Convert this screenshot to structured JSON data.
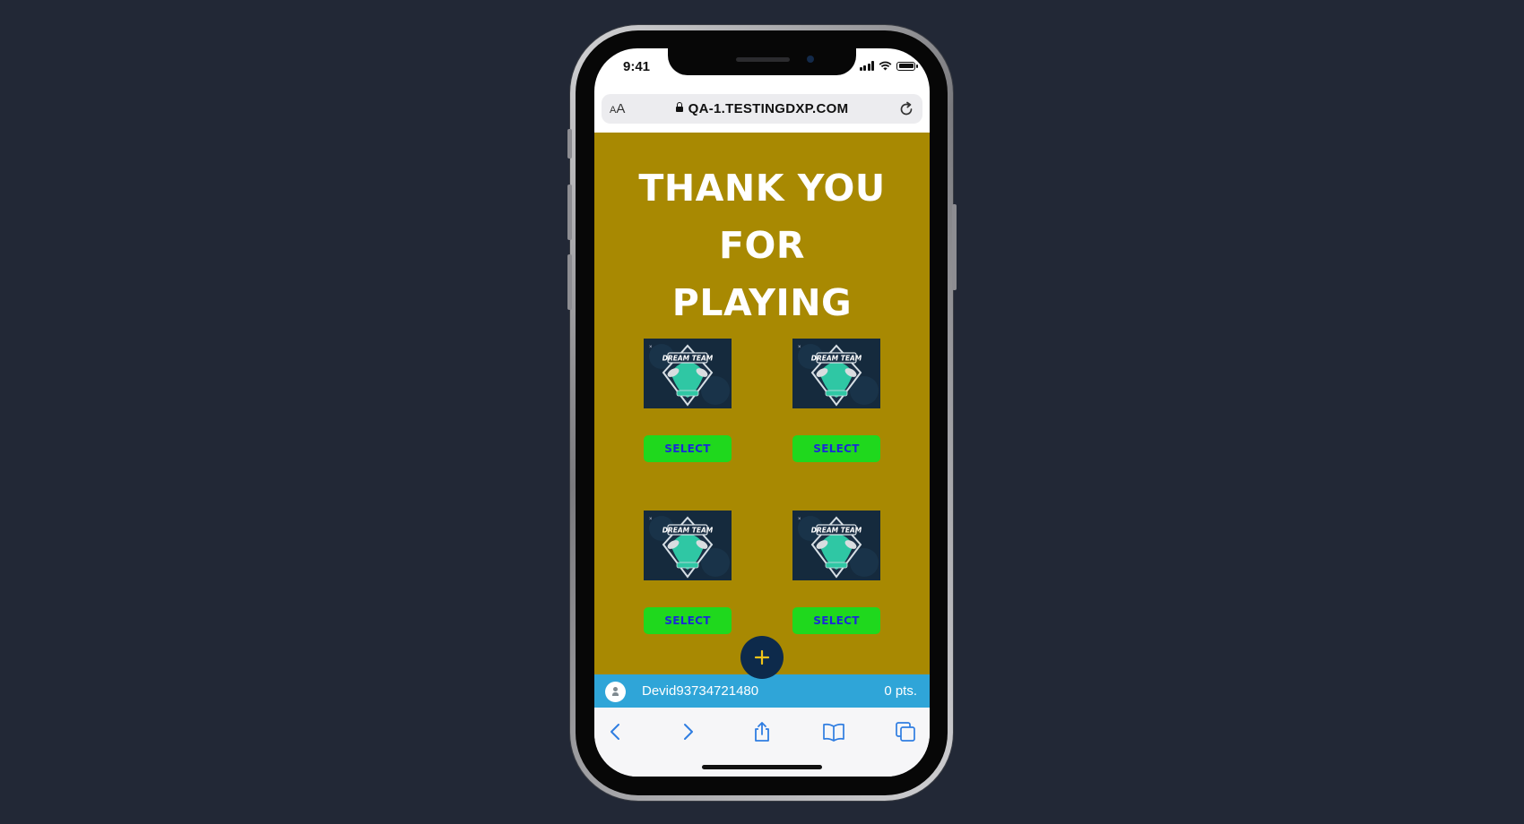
{
  "status_bar": {
    "time": "9:41"
  },
  "browser": {
    "text_size_label": "AA",
    "url": "QA-1.TESTINGDXP.COM"
  },
  "page": {
    "heading_line1": "THANK YOU FOR",
    "heading_line2": "PLAYING",
    "cards": [
      {
        "logo_text": "DREAM TEAM",
        "select_label": "SELECT"
      },
      {
        "logo_text": "DREAM TEAM",
        "select_label": "SELECT"
      },
      {
        "logo_text": "DREAM TEAM",
        "select_label": "SELECT"
      },
      {
        "logo_text": "DREAM TEAM",
        "select_label": "SELECT"
      }
    ]
  },
  "fab": {
    "icon": "plus-icon",
    "label": "+"
  },
  "user_bar": {
    "username": "Devid93734721480",
    "points": "0 pts."
  },
  "toolbar": {
    "icons": [
      "back-icon",
      "forward-icon",
      "share-icon",
      "bookmarks-icon",
      "tabs-icon"
    ]
  },
  "colors": {
    "page_background": "#a88902",
    "select_button": "#1fd81d",
    "select_text": "#1a2bd6",
    "user_bar": "#2fa5d8",
    "fab": "#0d2a4b",
    "fab_plus": "#f0c419"
  }
}
